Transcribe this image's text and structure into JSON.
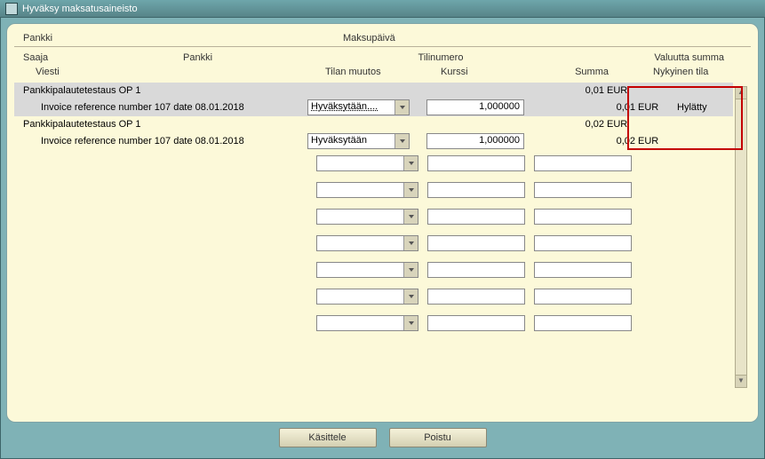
{
  "window": {
    "title": "Hyväksy maksatusaineisto"
  },
  "top": {
    "pankki": "Pankki",
    "maksupaiva": "Maksupäivä"
  },
  "headers": {
    "saaja": "Saaja",
    "pankki": "Pankki",
    "tilinumero": "Tilinumero",
    "valuutta_summa": "Valuutta summa",
    "viesti": "Viesti",
    "tilan_muutos": "Tilan muutos",
    "kurssi": "Kurssi",
    "summa": "Summa",
    "nykyinen_tila": "Nykyinen tila"
  },
  "groups": [
    {
      "title": "Pankkipalautetestaus OP 1",
      "amount": "0,01",
      "currency": "EUR",
      "selected": true,
      "row": {
        "message": "Invoice reference number 107 date 08.01.2018",
        "tilan": "Hyväksytään....",
        "kurssi": "1,000000",
        "summa": "0,01",
        "cur": "EUR",
        "nyk": "Hylätty"
      }
    },
    {
      "title": "Pankkipalautetestaus OP 1",
      "amount": "0,02",
      "currency": "EUR",
      "selected": false,
      "row": {
        "message": "Invoice reference number 107 date 08.01.2018",
        "tilan": "Hyväksytään",
        "kurssi": "1,000000",
        "summa": "0,02",
        "cur": "EUR",
        "nyk": ""
      }
    }
  ],
  "buttons": {
    "kasittele": "Käsittele",
    "poistu": "Poistu"
  }
}
